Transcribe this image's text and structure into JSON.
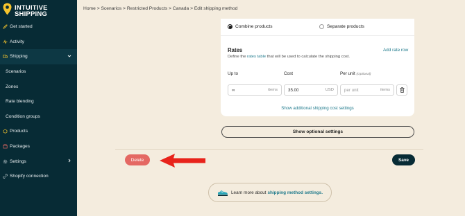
{
  "brand": {
    "line1": "INTUITIVE",
    "line2": "SHIPPING"
  },
  "sidebar": {
    "items": [
      {
        "label": "Get started",
        "icon": "rocket-icon"
      },
      {
        "label": "Activity",
        "icon": "activity-icon"
      },
      {
        "label": "Shipping",
        "icon": "truck-icon",
        "expanded": true
      },
      {
        "label": "Scenarios"
      },
      {
        "label": "Zones"
      },
      {
        "label": "Rate blending"
      },
      {
        "label": "Condition groups"
      },
      {
        "label": "Products",
        "icon": "products-icon"
      },
      {
        "label": "Packages",
        "icon": "packages-icon"
      },
      {
        "label": "Settings",
        "icon": "gear-icon"
      },
      {
        "label": "Shopify connection",
        "icon": "link-icon"
      }
    ]
  },
  "breadcrumb": "Home > Scenarios > Restricted Products > Canada > Edit shipping method",
  "options": {
    "combine": "Combine products",
    "separate": "Separate products",
    "selected": "combine"
  },
  "rates": {
    "title": "Rates",
    "desc_before": "Define the ",
    "desc_link": "rates table",
    "desc_after": " that will be used to calculate the shipping cost.",
    "add_row": "Add rate row",
    "headers": {
      "up_to": "Up to",
      "cost": "Cost",
      "per_unit": "Per unit",
      "optional": "(Optional)"
    },
    "row": {
      "up_to_value": "∞",
      "up_to_unit": "items",
      "cost_value": "35.00",
      "cost_unit": "USD",
      "per_unit_placeholder": "per unit",
      "per_unit_unit": "items"
    },
    "show_additional": "Show additional shipping cost settings"
  },
  "buttons": {
    "show_optional": "Show optional settings",
    "delete": "Delete",
    "save": "Save"
  },
  "learn": {
    "before": "Learn more about ",
    "link": "shipping method settings."
  },
  "colors": {
    "sidebar": "#072b35",
    "background": "#f4ecde",
    "accent": "#1f7a8c",
    "delete": "#e46863",
    "arrow": "#e8231b",
    "logo_yellow": "#f6c42c"
  }
}
